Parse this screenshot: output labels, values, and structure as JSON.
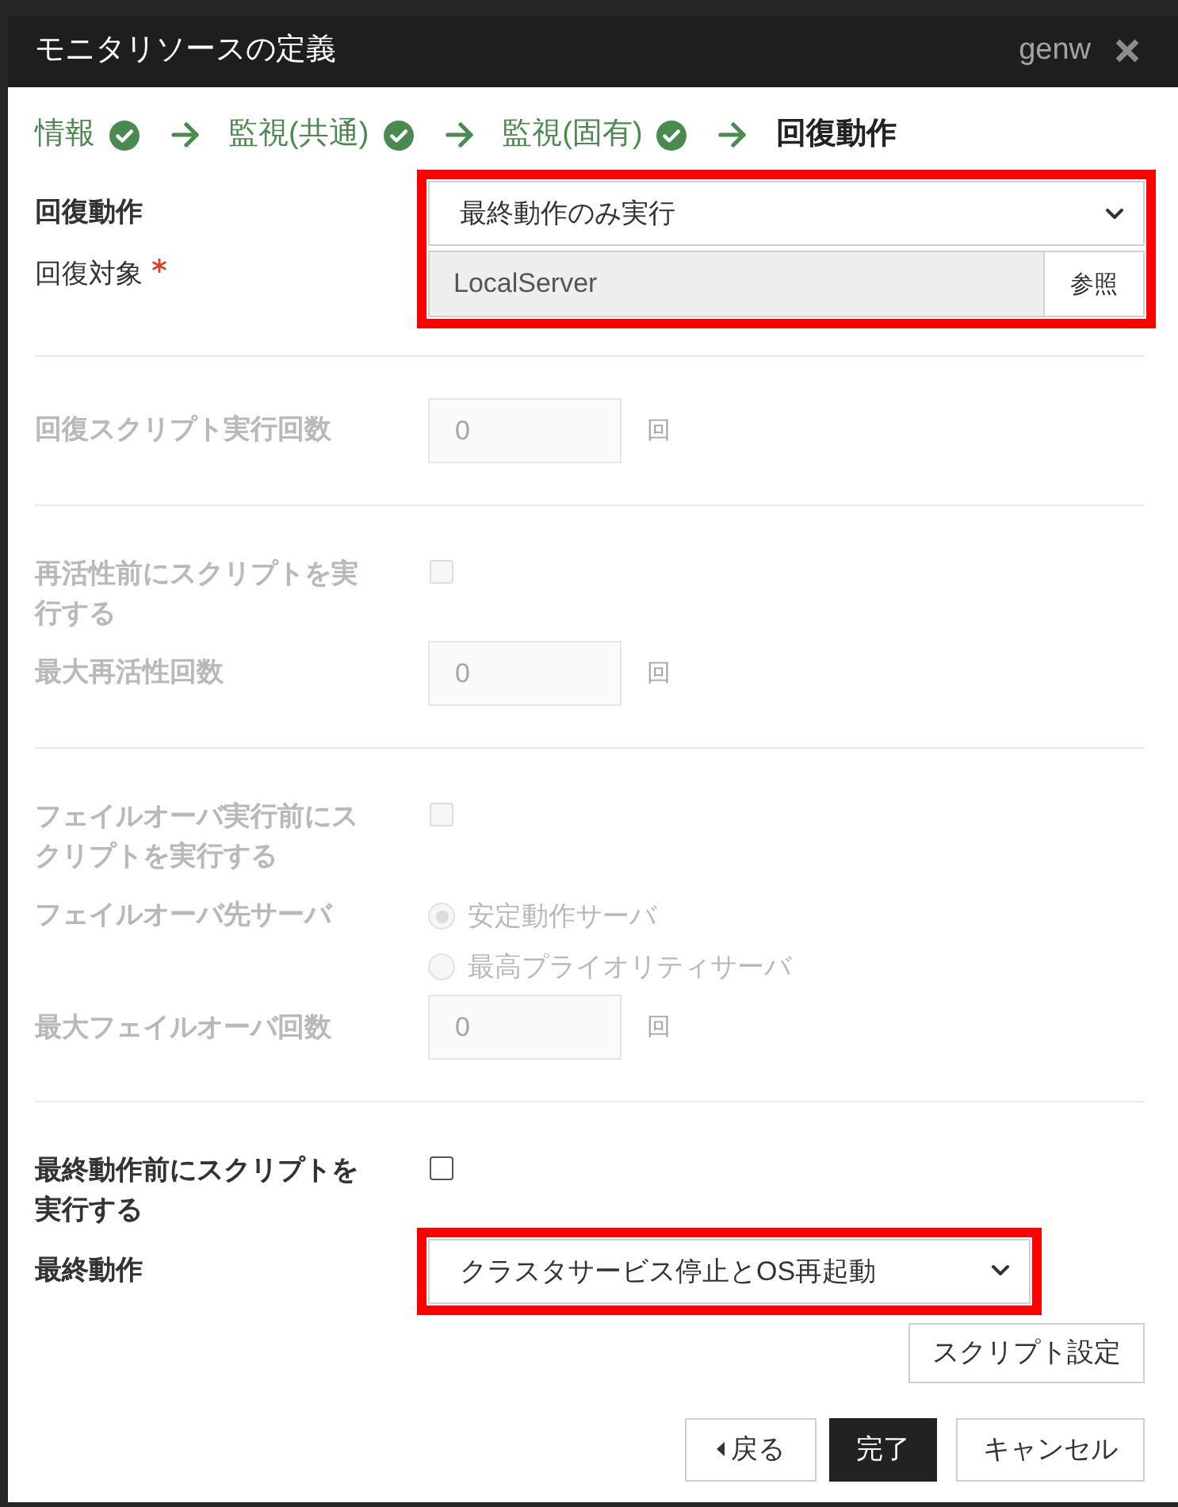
{
  "dialog": {
    "title": "モニタリソースの定義",
    "user": "genw"
  },
  "steps": [
    {
      "label": "情報",
      "done": true,
      "selected": false
    },
    {
      "label": "監視(共通)",
      "done": true,
      "selected": false
    },
    {
      "label": "監視(固有)",
      "done": true,
      "selected": false
    },
    {
      "label": "回復動作",
      "done": false,
      "selected": true
    }
  ],
  "sections": [
    {
      "rows": [
        {
          "kind": "select",
          "label": "回復動作",
          "bold": true,
          "disabled": false,
          "highlighted": true,
          "value": "最終動作のみ実行"
        },
        {
          "kind": "browse",
          "label": "回復対象",
          "bold": false,
          "required": true,
          "disabled": false,
          "highlighted": true,
          "readonly": true,
          "value": "LocalServer",
          "button": "参照"
        }
      ]
    },
    {
      "rows": [
        {
          "kind": "number",
          "label": "回復スクリプト実行回数",
          "bold": true,
          "disabled": true,
          "highlighted": false,
          "value": "0",
          "unit": "回"
        }
      ]
    },
    {
      "rows": [
        {
          "kind": "checkbox",
          "label": "再活性前にスクリプトを実行する",
          "bold": true,
          "disabled": true,
          "highlighted": false,
          "checked": false
        },
        {
          "kind": "number",
          "label": "最大再活性回数",
          "bold": true,
          "disabled": true,
          "highlighted": false,
          "value": "0",
          "unit": "回"
        }
      ]
    },
    {
      "rows": [
        {
          "kind": "checkbox",
          "label": "フェイルオーバ実行前にスクリプトを実行する",
          "bold": true,
          "disabled": true,
          "highlighted": false,
          "checked": false
        },
        {
          "kind": "radio",
          "label": "フェイルオーバ先サーバ",
          "bold": true,
          "disabled": true,
          "highlighted": false,
          "options": [
            {
              "label": "安定動作サーバ",
              "selected": true
            },
            {
              "label": "最高プライオリティサーバ",
              "selected": false
            }
          ]
        },
        {
          "kind": "number",
          "label": "最大フェイルオーバ回数",
          "bold": true,
          "disabled": true,
          "highlighted": false,
          "value": "0",
          "unit": "回"
        }
      ]
    },
    {
      "rows": [
        {
          "kind": "checkbox",
          "label": "最終動作前にスクリプトを実行する",
          "bold": true,
          "disabled": false,
          "highlighted": false,
          "checked": false
        },
        {
          "kind": "select",
          "label": "最終動作",
          "bold": true,
          "disabled": false,
          "highlighted": true,
          "value": "クラスタサービス停止とOS再起動"
        },
        {
          "kind": "button",
          "disabled": false,
          "highlighted": false,
          "text": "スクリプト設定"
        }
      ]
    }
  ],
  "footer": [
    {
      "label": "戻る",
      "kind": "back"
    },
    {
      "label": "完了",
      "kind": "primary"
    },
    {
      "label": "キャンセル",
      "kind": "default"
    }
  ]
}
